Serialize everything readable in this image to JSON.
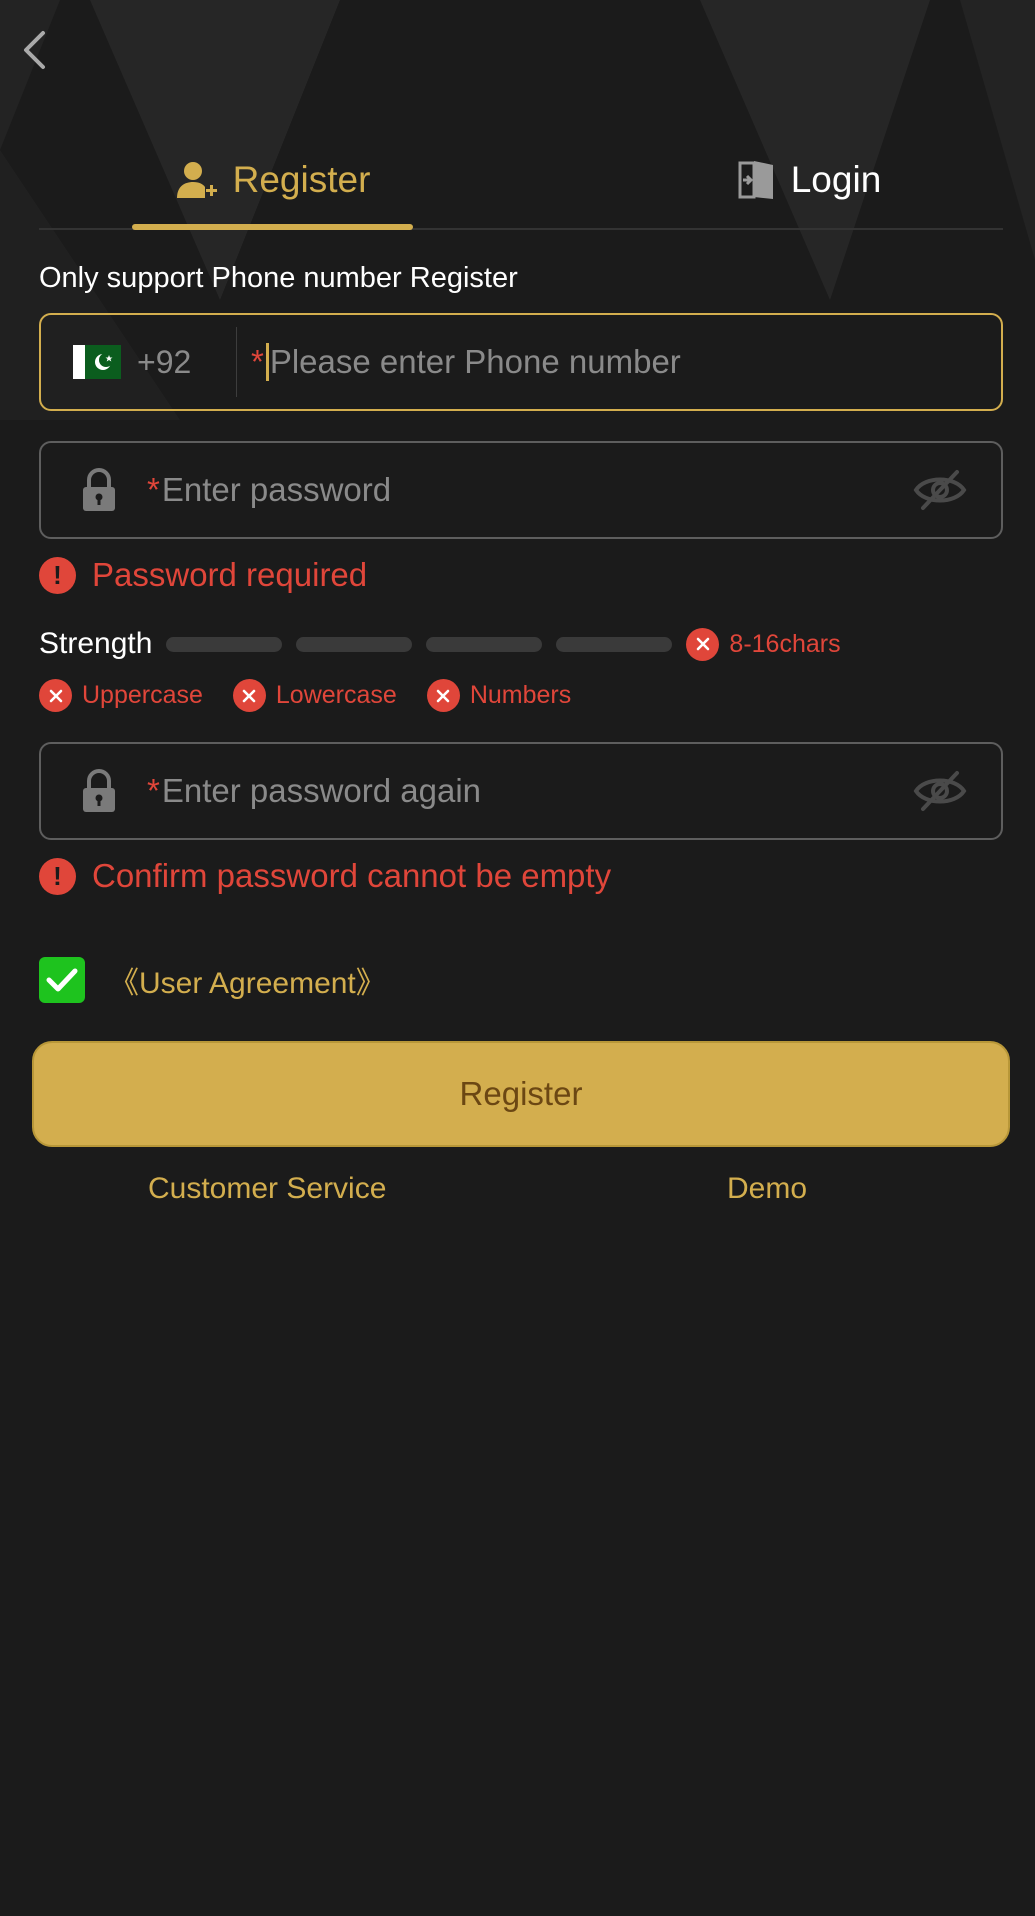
{
  "header": {
    "back_icon": "chevron-left-icon"
  },
  "tabs": [
    {
      "label": "Register",
      "icon": "user-add-icon",
      "active": true
    },
    {
      "label": "Login",
      "icon": "login-door-icon",
      "active": false
    }
  ],
  "form": {
    "hint": "Only support Phone number Register",
    "phone": {
      "country_flag": "pakistan-flag-icon",
      "country_code": "+92",
      "required_mark": "*",
      "placeholder": "Please enter Phone number",
      "value": ""
    },
    "password": {
      "required_mark": "*",
      "placeholder": "Enter password",
      "value": "",
      "error": "Password required"
    },
    "strength": {
      "label": "Strength",
      "level": 0,
      "segments": 4,
      "rules": [
        "8-16chars",
        "Uppercase",
        "Lowercase",
        "Numbers"
      ]
    },
    "confirm_password": {
      "required_mark": "*",
      "placeholder": "Enter password again",
      "value": "",
      "error": "Confirm password cannot be empty"
    },
    "agreement": {
      "checked": true,
      "label": "《User Agreement》"
    },
    "submit_label": "Register"
  },
  "footer": {
    "customer_service": "Customer Service",
    "demo": "Demo"
  },
  "colors": {
    "background": "#1b1b1b",
    "accent": "#d3ae4e",
    "error": "#e0463a",
    "checkbox": "#1ec31e"
  }
}
